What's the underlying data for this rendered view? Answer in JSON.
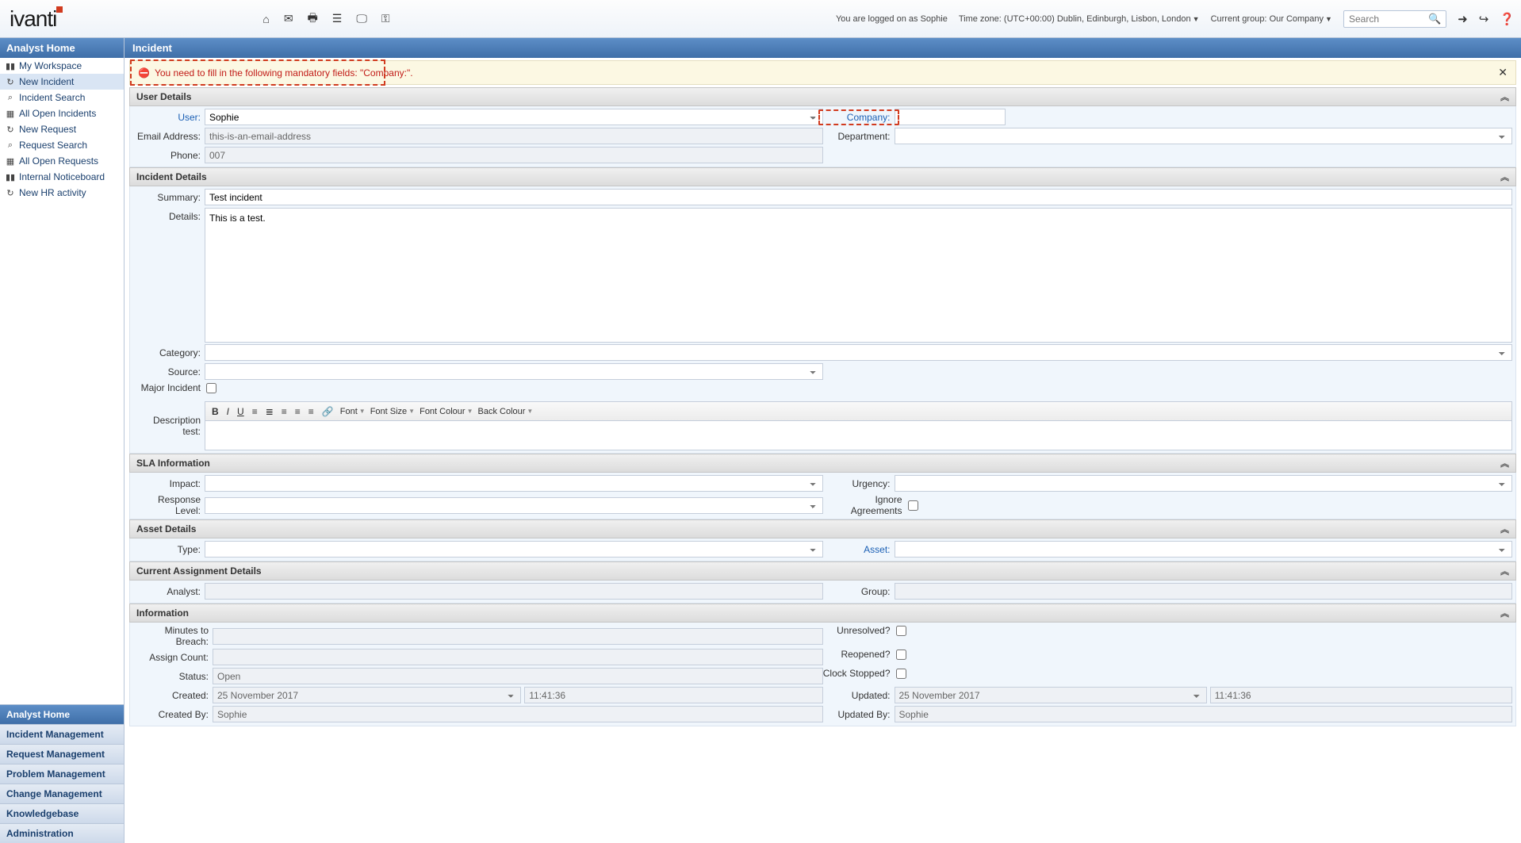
{
  "logo": "ivanti",
  "top_icons": [
    "home",
    "mail",
    "print",
    "list",
    "monitor",
    "key"
  ],
  "top_right": {
    "logged": "You are logged on as Sophie",
    "tz_label": "Time zone:",
    "tz_value": "(UTC+00:00) Dublin, Edinburgh, Lisbon, London",
    "group_label": "Current group:",
    "group_value": "Our Company",
    "search_placeholder": "Search"
  },
  "sidebar": {
    "title": "Analyst Home",
    "items": [
      {
        "icon": "chart",
        "label": "My Workspace"
      },
      {
        "icon": "refresh",
        "label": "New Incident"
      },
      {
        "icon": "search",
        "label": "Incident Search"
      },
      {
        "icon": "grid",
        "label": "All Open Incidents"
      },
      {
        "icon": "refresh",
        "label": "New Request"
      },
      {
        "icon": "search",
        "label": "Request Search"
      },
      {
        "icon": "grid",
        "label": "All Open Requests"
      },
      {
        "icon": "chart",
        "label": "Internal Noticeboard"
      },
      {
        "icon": "refresh",
        "label": "New HR activity"
      }
    ],
    "bottom": [
      "Analyst Home",
      "Incident Management",
      "Request Management",
      "Problem Management",
      "Change Management",
      "Knowledgebase",
      "Administration"
    ]
  },
  "content_title": "Incident",
  "alert_text": "You need to fill in the following mandatory fields: \"Company:\".",
  "sections": {
    "user_details": "User Details",
    "incident_details": "Incident Details",
    "sla": "SLA Information",
    "asset": "Asset Details",
    "assignment": "Current Assignment Details",
    "info": "Information"
  },
  "labels": {
    "user": "User:",
    "company": "Company:",
    "email": "Email Address:",
    "department": "Department:",
    "phone": "Phone:",
    "summary": "Summary:",
    "details": "Details:",
    "category": "Category:",
    "source": "Source:",
    "major": "Major Incident",
    "desc_test": "Description test:",
    "impact": "Impact:",
    "urgency": "Urgency:",
    "response": "Response Level:",
    "ignore": "Ignore Agreements",
    "type": "Type:",
    "asset": "Asset:",
    "analyst": "Analyst:",
    "group": "Group:",
    "minutes": "Minutes to Breach:",
    "unresolved": "Unresolved?",
    "assign_count": "Assign Count:",
    "reopened": "Reopened?",
    "status": "Status:",
    "clock": "Clock Stopped?",
    "created": "Created:",
    "updated": "Updated:",
    "created_by": "Created By:",
    "updated_by": "Updated By:"
  },
  "values": {
    "user": "Sophie",
    "email": "this-is-an-email-address",
    "phone": "007",
    "summary": "Test incident",
    "details": "This is a test.",
    "status": "Open",
    "created_date": "25 November 2017",
    "created_time": "11:41:36",
    "updated_date": "25 November 2017",
    "updated_time": "11:41:36",
    "created_by": "Sophie",
    "updated_by": "Sophie"
  },
  "rte": {
    "font": "Font",
    "size": "Font Size",
    "colour": "Font Colour",
    "back": "Back Colour"
  }
}
